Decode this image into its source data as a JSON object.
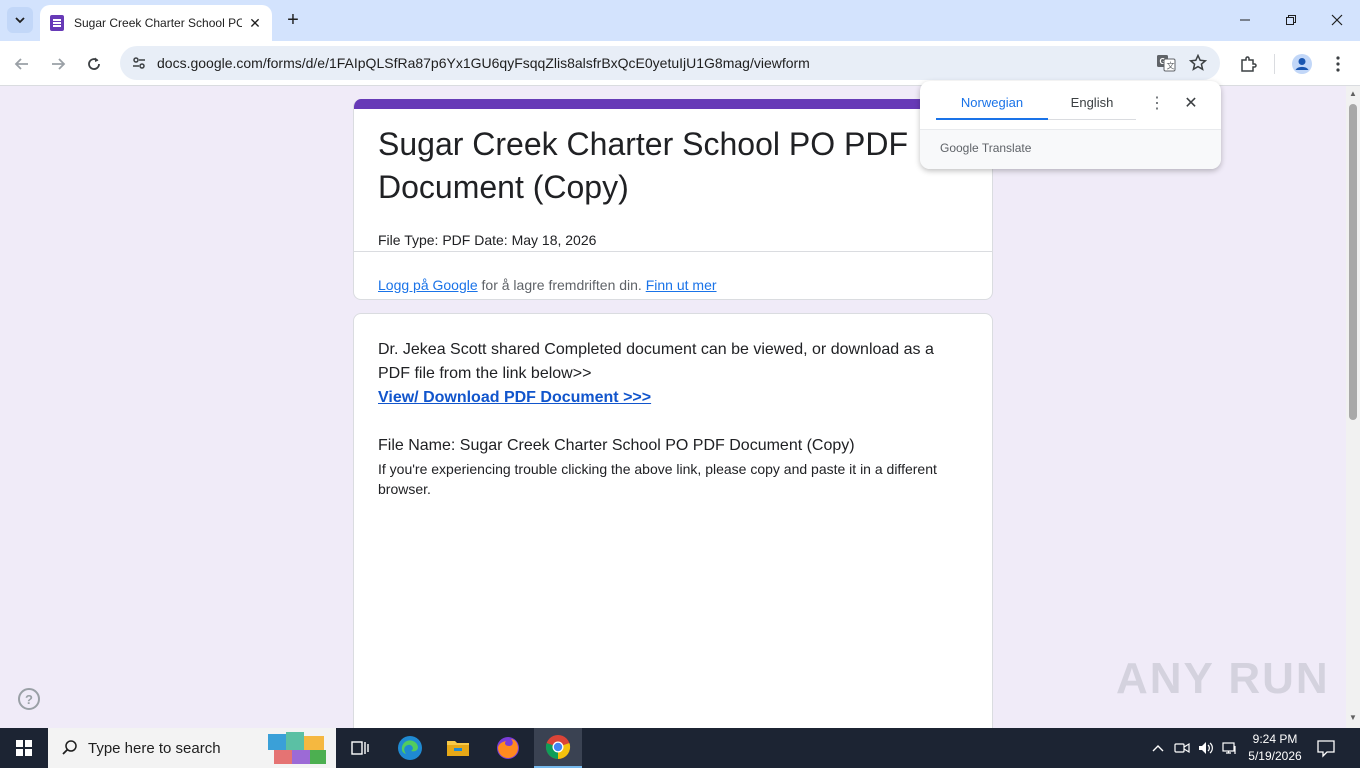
{
  "browser": {
    "tab_title": "Sugar Creek Charter School PO PDF Document (Copy)",
    "url": "docs.google.com/forms/d/e/1FAIpQLSfRa87p6Yx1GU6qyFsqqZlis8alsfrBxQcE0yetuIjU1G8mag/viewform"
  },
  "form": {
    "title": "Sugar Creek Charter School PO PDF Document (Copy)",
    "description": "File Type: PDF Date: May 18, 2026",
    "signin_link": "Logg på Google",
    "signin_text": " for å lagre fremdriften din. ",
    "learn_more": "Finn ut mer",
    "body_text": "Dr. Jekea Scott shared Completed document can be viewed, or download as a PDF file from the link below>>",
    "download_link": "View/ Download PDF Document >>>",
    "file_name": "File Name: Sugar Creek Charter School PO PDF Document (Copy)",
    "trouble_text": "If you're experiencing trouble clicking the above link, please copy and paste it in a different browser."
  },
  "translate": {
    "source_lang": "Norwegian",
    "target_lang": "English",
    "brand": "Google Translate"
  },
  "taskbar": {
    "search_placeholder": "Type here to search",
    "time": "9:24 PM",
    "date": "5/19/2026"
  },
  "watermark": "ANY RUN",
  "colors": {
    "form_accent": "#673ab7",
    "link": "#1a73e8",
    "page_bg": "#f0ebf8",
    "tabstrip": "#d3e3fd"
  }
}
